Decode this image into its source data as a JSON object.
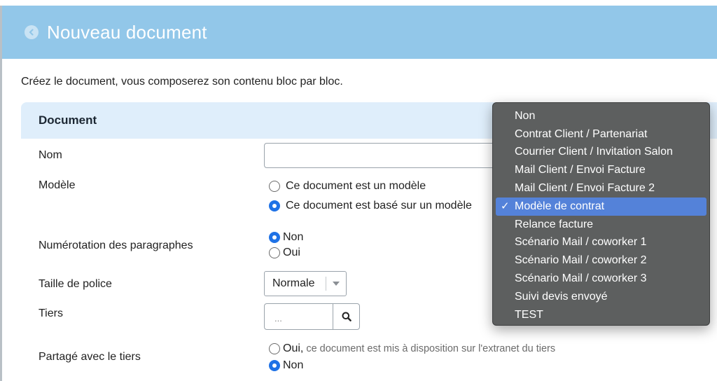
{
  "header": {
    "title": "Nouveau document"
  },
  "intro": "Créez le document, vous composerez son contenu bloc par bloc.",
  "panel": {
    "title": "Document"
  },
  "form": {
    "name_label": "Nom",
    "name_value": "",
    "model_label": "Modèle",
    "model_options": [
      "Ce document est un modèle",
      "Ce document est basé sur un modèle"
    ],
    "numbering_label": "Numérotation des paragraphes",
    "numbering_options": [
      "Non",
      "Oui"
    ],
    "font_size_label": "Taille de police",
    "font_size_value": "Normale",
    "tiers_label": "Tiers",
    "tiers_placeholder": "...",
    "shared_label": "Partagé avec le tiers",
    "shared_yes": "Oui,",
    "shared_yes_hint": "ce document est mis à disposition sur l'extranet du tiers",
    "shared_no": "Non"
  },
  "dropdown": {
    "options": [
      "Non",
      "Contrat Client / Partenariat",
      "Courrier Client / Invitation Salon",
      "Mail Client / Envoi Facture",
      "Mail Client / Envoi Facture 2",
      "Modèle de contrat",
      "Relance facture",
      "Scénario Mail / coworker 1",
      "Scénario Mail / coworker 2",
      "Scénario Mail / coworker 3",
      "Suivi devis envoyé",
      "TEST"
    ],
    "selected": "Modèle de contrat",
    "check": "✓"
  },
  "colors": {
    "header_bg": "#92c7e9",
    "panel_head_bg": "#dfeefb",
    "radio_on": "#1f72e6",
    "dropdown_bg": "#5d5f5f",
    "dropdown_highlight": "#5482d9"
  }
}
